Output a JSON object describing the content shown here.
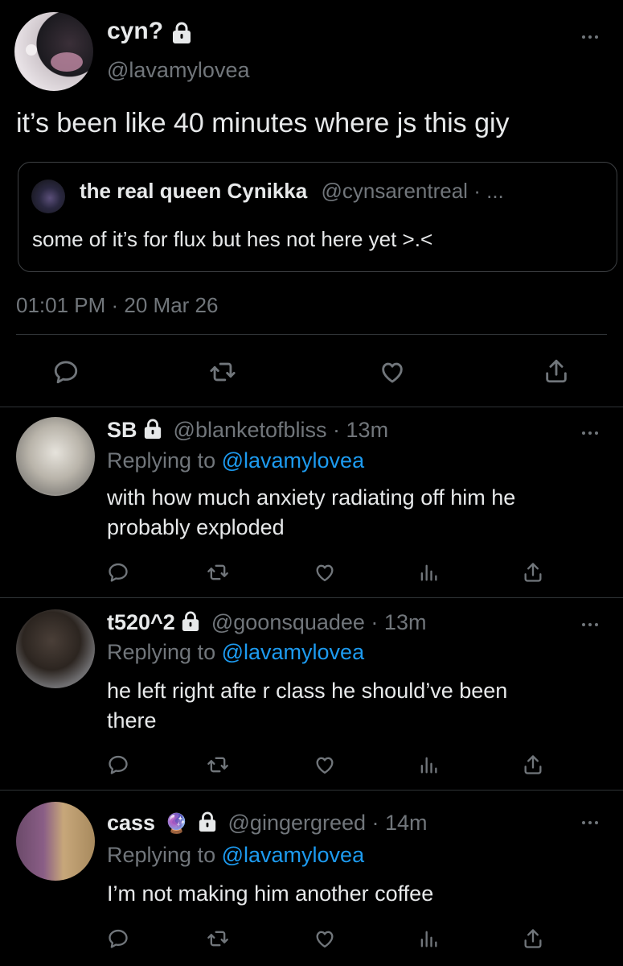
{
  "colors": {
    "background": "#000000",
    "text": "#e7e9ea",
    "muted": "#71767b",
    "link": "#1d9bf0",
    "divider": "#2f3336"
  },
  "main_tweet": {
    "display_name": "cyn?",
    "handle": "@lavamylovea",
    "text": "it’s been like 40 minutes where js this giy",
    "quote": {
      "display_name": "the real queen Cynikka",
      "handle": "@cynsarentreal",
      "separator": "·",
      "more": "...",
      "text": "some of it’s for flux but hes not here yet >.<"
    },
    "timestamp": "01:01 PM · 20 Mar 26",
    "icons": [
      "reply-icon",
      "retweet-icon",
      "like-icon",
      "share-icon"
    ]
  },
  "replies": [
    {
      "display_name": "SB",
      "handle_time": "@blanketofbliss · 13m",
      "replying_prefix": "Replying to",
      "replying_to": "@lavamylovea",
      "text_lines": [
        "with how much anxiety radiating off him he",
        "probably exploded"
      ]
    },
    {
      "display_name": "t520^2",
      "handle_time": "@goonsquadee · 13m",
      "replying_prefix": "Replying to",
      "replying_to": "@lavamylovea",
      "text_lines": [
        "he left right afte r class he should’ve been",
        "there"
      ]
    },
    {
      "display_name": "cass",
      "emoji": "🔮",
      "handle_time": "@gingergreed · 14m",
      "replying_prefix": "Replying to",
      "replying_to": "@lavamylovea",
      "text_lines": [
        "I’m not making him another coffee"
      ]
    }
  ]
}
